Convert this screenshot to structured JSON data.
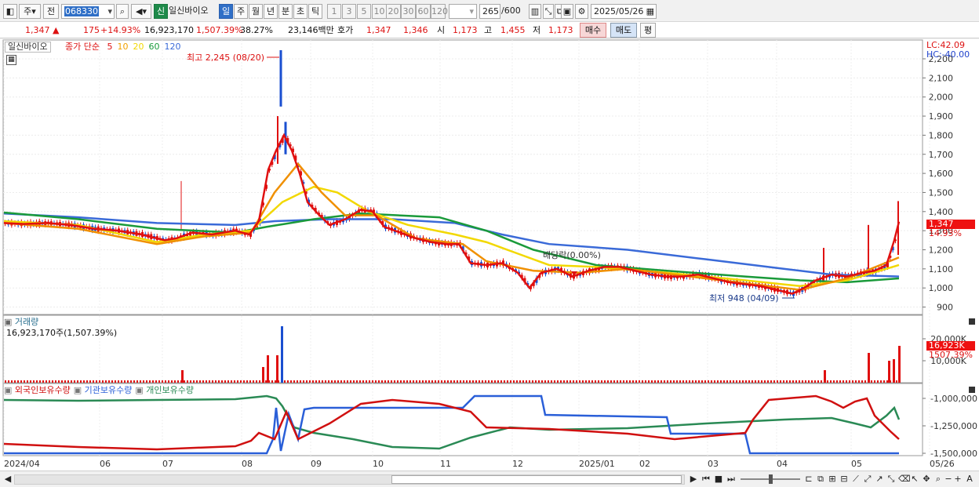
{
  "toolbar": {
    "market_select": "주",
    "prev_label": "전",
    "stock_code": "068330",
    "credit_badge": "신",
    "stock_name": "일신바이오",
    "periods": [
      "일",
      "주",
      "월",
      "년",
      "분",
      "초",
      "틱"
    ],
    "active_period": "일",
    "intervals": [
      "1",
      "3",
      "5",
      "10",
      "20",
      "30",
      "60",
      "120"
    ],
    "count": "265",
    "count_total": "/600",
    "date": "2025/05/26"
  },
  "quote": {
    "price": "1,347",
    "arrow": "▲",
    "change": "175",
    "change_pct": "+14.93%",
    "volume": "16,923,170",
    "volume_pct": "1,507.39%",
    "turnover": "38.27%",
    "amount": "23,146백만",
    "hoga_label": "호가",
    "ask": "1,347",
    "bid": "1,346",
    "open_label": "시",
    "open": "1,173",
    "high_label": "고",
    "high": "1,455",
    "low_label": "저",
    "low": "1,173",
    "buy_label": "매수",
    "sell_label": "매도",
    "avg_label": "평"
  },
  "price_pane": {
    "name_label": "일신바이오",
    "ma_label": "종가 단순",
    "ma_periods": [
      {
        "label": "5",
        "color": "#e01010"
      },
      {
        "label": "10",
        "color": "#f0a000"
      },
      {
        "label": "20",
        "color": "#f2d800"
      },
      {
        "label": "60",
        "color": "#1a9a3a"
      },
      {
        "label": "120",
        "color": "#3a6ad8"
      }
    ],
    "lc": "LC:42.09",
    "hc": "HC:-40.00",
    "yticks": [
      "2,200",
      "2,100",
      "2,000",
      "1,900",
      "1,800",
      "1,700",
      "1,600",
      "1,500",
      "1,400",
      "1,300",
      "1,200",
      "1,100",
      "1,000",
      "900"
    ],
    "current_price_tag": "1,347",
    "current_pct_tag": "14.93%",
    "high_annotation": "최고 2,245 (08/20)",
    "low_annotation": "최저 948 (04/09)",
    "dividend_annotation": "배당락(0.00%)"
  },
  "volume_pane": {
    "title": "거래량",
    "value": "16,923,170주(1,507.39%)",
    "yticks": [
      "20,000K",
      "10,000K"
    ],
    "current_tag": "16,923K",
    "current_pct": "1507.39%"
  },
  "holdings_pane": {
    "legend": [
      {
        "label": "외국인보유수량",
        "color": "#d01010"
      },
      {
        "label": "기관보유수량",
        "color": "#2a5fd8"
      },
      {
        "label": "개인보유수량",
        "color": "#2a8a55"
      }
    ],
    "yticks": [
      "-1,000,000",
      "-1,250,000",
      "-1,500,000"
    ]
  },
  "x_axis": {
    "labels": [
      "2024/04",
      "06",
      "07",
      "08",
      "09",
      "10",
      "11",
      "12",
      "2025/01",
      "02",
      "03",
      "04",
      "05",
      "05/26"
    ]
  },
  "colors": {
    "up": "#e01010",
    "down": "#1a4fd0",
    "ma5": "#e01010",
    "ma10": "#f09000",
    "ma20": "#f2d800",
    "ma60": "#1a9a3a",
    "ma120": "#3a6ad8"
  }
}
